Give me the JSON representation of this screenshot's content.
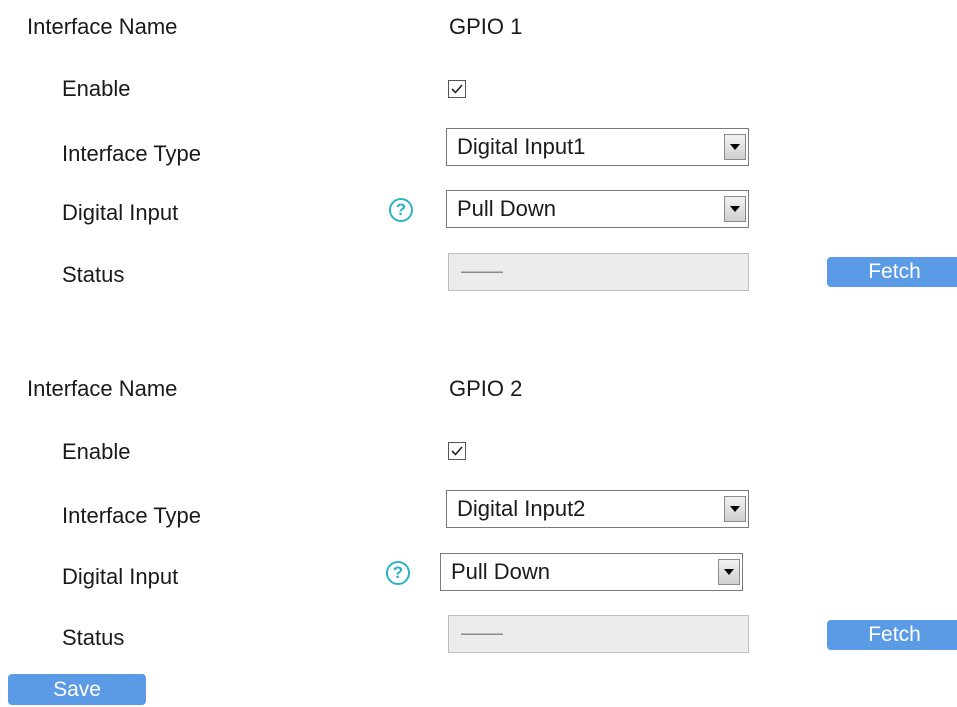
{
  "interfaces": [
    {
      "name_label": "Interface Name",
      "name_value": "GPIO 1",
      "enable_label": "Enable",
      "enabled": true,
      "type_label": "Interface Type",
      "type_value": "Digital Input1",
      "digital_input_label": "Digital Input",
      "digital_input_value": "Pull Down",
      "status_label": "Status",
      "status_value": "——",
      "fetch_label": "Fetch"
    },
    {
      "name_label": "Interface Name",
      "name_value": "GPIO 2",
      "enable_label": "Enable",
      "enabled": true,
      "type_label": "Interface Type",
      "type_value": "Digital Input2",
      "digital_input_label": "Digital Input",
      "digital_input_value": "Pull Down",
      "status_label": "Status",
      "status_value": "——",
      "fetch_label": "Fetch"
    }
  ],
  "help_icon": "help-question-icon",
  "save_label": "Save",
  "colors": {
    "button": "#5b9be6",
    "help": "#2bb3c5"
  }
}
